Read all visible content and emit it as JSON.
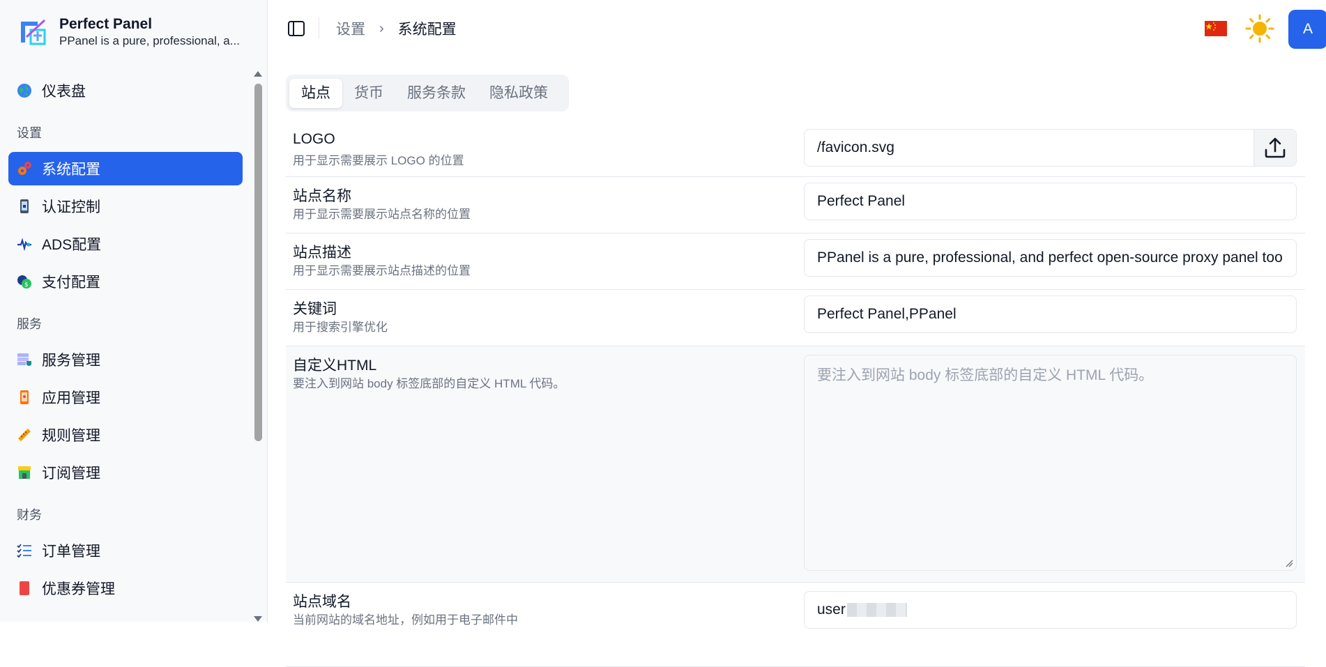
{
  "brand": {
    "name": "Perfect Panel",
    "description": "PPanel is a pure, professional, a..."
  },
  "sidebar": {
    "dashboard": "仪表盘",
    "groups": [
      {
        "label": "设置",
        "items": [
          "系统配置",
          "认证控制",
          "ADS配置",
          "支付配置"
        ]
      },
      {
        "label": "服务",
        "items": [
          "服务管理",
          "应用管理",
          "规则管理",
          "订阅管理"
        ]
      },
      {
        "label": "财务",
        "items": [
          "订单管理",
          "优惠券管理"
        ]
      }
    ],
    "active": "系统配置"
  },
  "header": {
    "breadcrumb": [
      "设置",
      "系统配置"
    ],
    "avatar_letter": "A",
    "language_flag": "china-flag",
    "theme_icon": "sun-icon"
  },
  "tabs": [
    "站点",
    "货币",
    "服务条款",
    "隐私政策"
  ],
  "active_tab": "站点",
  "form": {
    "logo": {
      "title": "LOGO",
      "desc": "用于显示需要展示 LOGO 的位置",
      "value": "/favicon.svg"
    },
    "site_name": {
      "title": "站点名称",
      "desc": "用于显示需要展示站点名称的位置",
      "value": "Perfect Panel"
    },
    "site_desc": {
      "title": "站点描述",
      "desc": "用于显示需要展示站点描述的位置",
      "value": "PPanel is a pure, professional, and perfect open-source proxy panel too"
    },
    "keywords": {
      "title": "关键词",
      "desc": "用于搜索引擎优化",
      "value": "Perfect Panel,PPanel"
    },
    "custom_html": {
      "title": "自定义HTML",
      "desc": "要注入到网站 body 标签底部的自定义 HTML 代码。",
      "placeholder": "要注入到网站 body 标签底部的自定义 HTML 代码。"
    },
    "domain": {
      "title": "站点域名",
      "desc": "当前网站的域名地址，例如用于电子邮件中",
      "value": "user"
    }
  },
  "colors": {
    "accent": "#2563eb",
    "flag": "#de2910",
    "sun": "#f5b400"
  }
}
